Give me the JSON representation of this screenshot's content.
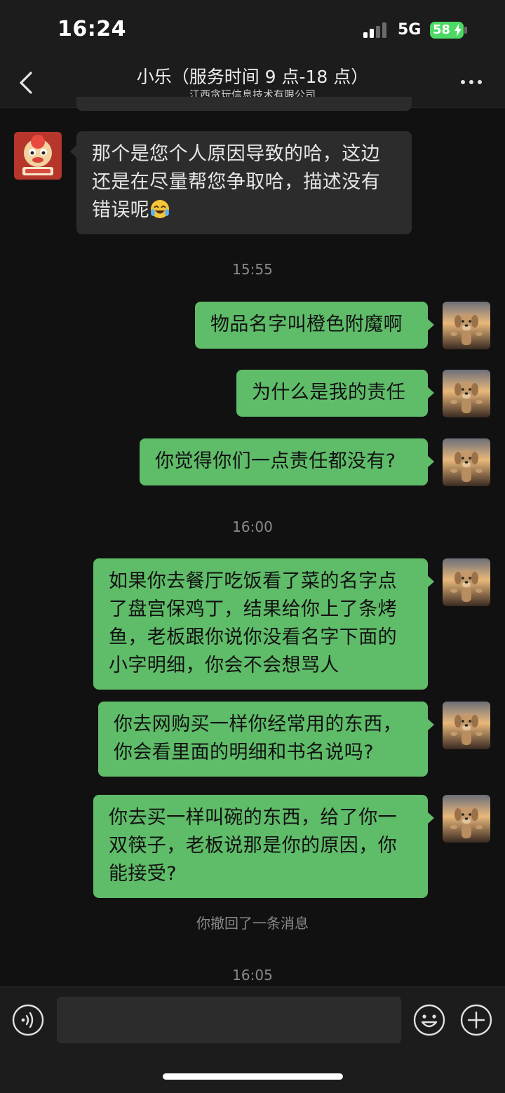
{
  "status_bar": {
    "time": "16:24",
    "network": "5G",
    "battery": "58"
  },
  "header": {
    "title": "小乐（服务时间 9 点-18 点）",
    "subtitle": "江西贪玩信息技术有限公司"
  },
  "messages": [
    {
      "side": "in",
      "text": "那个是您个人原因导致的哈，这边还是在尽量帮您争取哈，描述没有错误呢",
      "trailing_emoji": "laughing-crying-emoji"
    },
    {
      "side": "out",
      "text": "物品名字叫橙色附魔啊"
    },
    {
      "side": "out",
      "text": "为什么是我的责任"
    },
    {
      "side": "out",
      "text": "你觉得你们一点责任都没有?"
    },
    {
      "side": "out",
      "text": "如果你去餐厅吃饭看了菜的名字点了盘宫保鸡丁，结果给你上了条烤鱼，老板跟你说你没看名字下面的小字明细，你会不会想骂人"
    },
    {
      "side": "out",
      "text": "你去网购买一样你经常用的东西，你会看里面的明细和书名说吗?"
    },
    {
      "side": "out",
      "text": "你去买一样叫碗的东西，给了你一双筷子，老板说那是你的原因，你能接受?"
    }
  ],
  "timestamps": [
    "15:55",
    "16:00",
    "16:05"
  ],
  "system_notice": "你撤回了一条消息",
  "icons": {
    "back": "chevron-left-icon",
    "more": "more-dots-icon",
    "voice": "voice-icon",
    "emoji": "smiley-icon",
    "plus": "plus-icon"
  },
  "colors": {
    "background": "#111111",
    "bar": "#1c1c1c",
    "incoming_bubble": "#2c2c2c",
    "outgoing_bubble": "#5fbc69",
    "battery": "#4cd964"
  }
}
